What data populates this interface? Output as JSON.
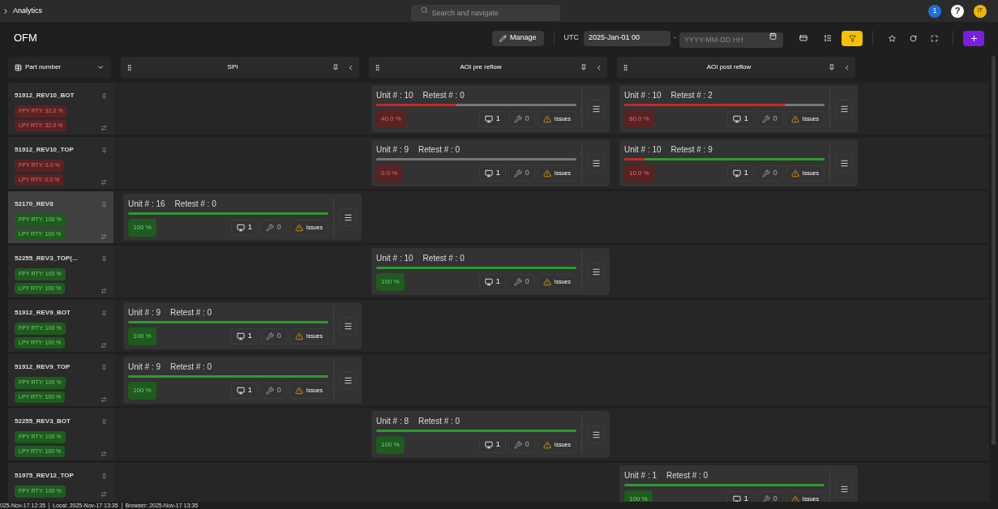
{
  "top_bar": {
    "breadcrumb": "Analytics",
    "search": {
      "placeholder": "Search and navigate"
    },
    "notification_count": "1",
    "help": "?",
    "avatar": "IT"
  },
  "header": {
    "title": "OFM",
    "manage": "Manage",
    "timezone": "UTC",
    "date_from": "2025-Jan-01 00",
    "range_separator": "-",
    "date_to": {
      "placeholder": "YYYY-MM-DD HH"
    },
    "filter_active": true
  },
  "columns": [
    {
      "kind": "part",
      "label": "Part number"
    },
    {
      "kind": "stage",
      "label": "SPI"
    },
    {
      "kind": "stage",
      "label": "AOI pre reflow"
    },
    {
      "kind": "stage",
      "label": "AOI post reflow"
    }
  ],
  "rows": [
    {
      "part": "51912_REV10_BOT",
      "selected": false,
      "failed": true,
      "badges": [
        "FPY RTY: 32.0 %",
        "LPY RTY: 32.0 %"
      ],
      "cells": [
        {
          "kind": "empty"
        },
        {
          "kind": "result",
          "unit": "Unit # : 10",
          "retest": "Retest # : 0",
          "segments": [
            {
              "kind": "fail",
              "level": 0.4
            }
          ],
          "yield": "40.0 %",
          "failed": true,
          "stations": "1",
          "repairs": "0",
          "issues": "Issues"
        },
        {
          "kind": "result",
          "unit": "Unit # : 10",
          "retest": "Retest # : 2",
          "segments": [
            {
              "kind": "fail",
              "level": 0.8
            }
          ],
          "yield": "80.0 %",
          "failed": true,
          "stations": "1",
          "repairs": "0",
          "issues": "Issues"
        }
      ]
    },
    {
      "part": "51912_REV10_TOP",
      "selected": false,
      "failed": true,
      "badges": [
        "FPY RTY: 0.0 %",
        "LPY RTY: 0.0 %"
      ],
      "cells": [
        {
          "kind": "empty"
        },
        {
          "kind": "result",
          "unit": "Unit # : 9",
          "retest": "Retest # : 0",
          "segments": [
            {
              "kind": "fail",
              "level": 0
            }
          ],
          "yield": "0.0 %",
          "failed": true,
          "stations": "1",
          "repairs": "0",
          "issues": "Issues"
        },
        {
          "kind": "result",
          "unit": "Unit # : 10",
          "retest": "Retest # : 9",
          "segments": [
            {
              "kind": "fail",
              "level": 0.1
            },
            {
              "kind": "pass",
              "level": 0.9
            }
          ],
          "yield": "10.0 %",
          "failed": true,
          "stations": "1",
          "repairs": "0",
          "issues": "Issues"
        }
      ]
    },
    {
      "part": "52170_REV8",
      "selected": true,
      "failed": false,
      "badges": [
        "FPY RTY: 100 %",
        "LPY RTY: 100 %"
      ],
      "cells": [
        {
          "kind": "result",
          "unit": "Unit # : 16",
          "retest": "Retest # : 0",
          "segments": [
            {
              "kind": "pass",
              "level": 1
            }
          ],
          "yield": "100 %",
          "failed": false,
          "stations": "1",
          "repairs": "0",
          "issues": "Issues"
        },
        {
          "kind": "empty"
        },
        {
          "kind": "empty"
        }
      ]
    },
    {
      "part": "52255_REV3_TOP(...",
      "selected": false,
      "failed": false,
      "badges": [
        "FPY RTY: 100 %",
        "LPY RTY: 100 %"
      ],
      "cells": [
        {
          "kind": "empty"
        },
        {
          "kind": "result",
          "unit": "Unit # : 10",
          "retest": "Retest # : 0",
          "segments": [
            {
              "kind": "pass",
              "level": 1
            }
          ],
          "yield": "100 %",
          "failed": false,
          "stations": "1",
          "repairs": "0",
          "issues": "Issues"
        },
        {
          "kind": "empty"
        }
      ]
    },
    {
      "part": "51912_REV9_BOT",
      "selected": false,
      "failed": false,
      "badges": [
        "FPY RTY: 100 %",
        "LPY RTY: 100 %"
      ],
      "cells": [
        {
          "kind": "result",
          "unit": "Unit # : 9",
          "retest": "Retest # : 0",
          "segments": [
            {
              "kind": "pass",
              "level": 1
            }
          ],
          "yield": "100 %",
          "failed": false,
          "stations": "1",
          "repairs": "0",
          "issues": "Issues"
        },
        {
          "kind": "empty"
        },
        {
          "kind": "empty"
        }
      ]
    },
    {
      "part": "51912_REV9_TOP",
      "selected": false,
      "failed": false,
      "badges": [
        "FPY RTY: 100 %",
        "LPY RTY: 100 %"
      ],
      "cells": [
        {
          "kind": "result",
          "unit": "Unit # : 9",
          "retest": "Retest # : 0",
          "segments": [
            {
              "kind": "pass",
              "level": 1
            }
          ],
          "yield": "100 %",
          "failed": false,
          "stations": "1",
          "repairs": "0",
          "issues": "Issues"
        },
        {
          "kind": "empty"
        },
        {
          "kind": "empty"
        }
      ]
    },
    {
      "part": "52255_REV3_BOT",
      "selected": false,
      "failed": false,
      "badges": [
        "FPY RTY: 100 %",
        "LPY RTY: 100 %"
      ],
      "cells": [
        {
          "kind": "empty"
        },
        {
          "kind": "result",
          "unit": "Unit # : 8",
          "retest": "Retest # : 0",
          "segments": [
            {
              "kind": "pass",
              "level": 1
            }
          ],
          "yield": "100 %",
          "failed": false,
          "stations": "1",
          "repairs": "0",
          "issues": "Issues"
        },
        {
          "kind": "empty"
        }
      ]
    },
    {
      "part": "51975_REV12_TOP",
      "selected": false,
      "failed": false,
      "badges": [
        "FPY RTY: 100 %"
      ],
      "cells": [
        {
          "kind": "empty"
        },
        {
          "kind": "empty"
        },
        {
          "kind": "result",
          "unit": "Unit # : 1",
          "retest": "Retest # : 0",
          "segments": [
            {
              "kind": "pass",
              "level": 1
            }
          ],
          "yield": "100 %",
          "failed": false,
          "stations": "1",
          "repairs": "0",
          "issues": "Issues"
        }
      ]
    }
  ],
  "footer": [
    "025-Nov-17 12:35",
    "Local: 2025-Nov-17 13:35",
    "Browser: 2025-Nov-17 13:35"
  ]
}
